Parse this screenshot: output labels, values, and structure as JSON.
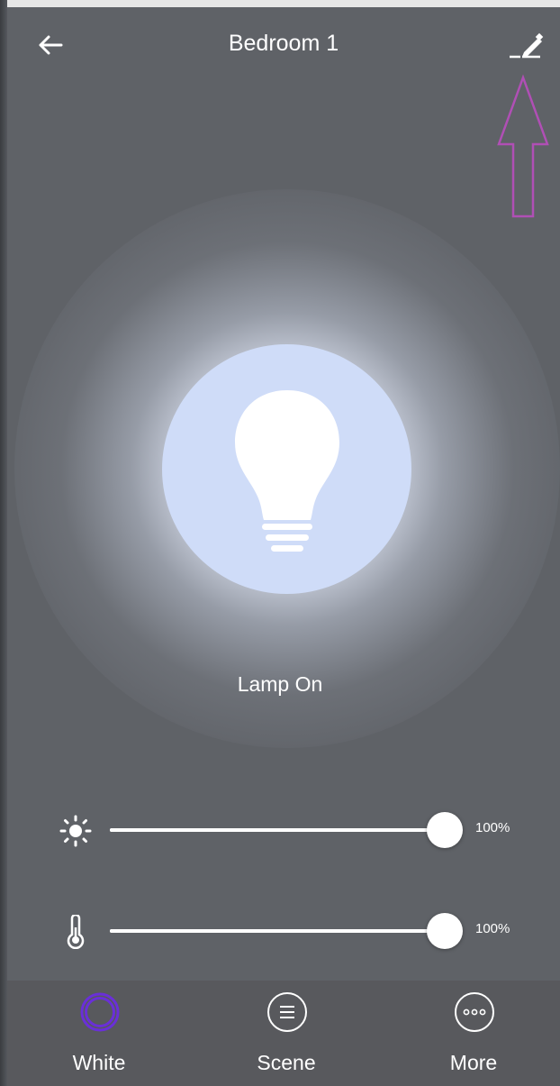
{
  "header": {
    "title": "Bedroom 1"
  },
  "icons": {
    "back": "arrow-left-icon",
    "edit": "pencil-edit-icon",
    "brightness": "sun-icon",
    "temperature": "thermometer-icon",
    "bulb": "light-bulb-icon",
    "white": "ring-icon",
    "scene": "menu-lines-icon",
    "more": "dots-icon"
  },
  "lamp": {
    "status": "Lamp On",
    "color": "#cfdcf8"
  },
  "sliders": {
    "brightness": {
      "value": 1.0,
      "label": "100%"
    },
    "temperature": {
      "value": 1.0,
      "label": "100%"
    }
  },
  "nav": {
    "items": [
      {
        "label": "White",
        "icon": "ring-icon",
        "active": true
      },
      {
        "label": "Scene",
        "icon": "menu-lines-icon",
        "active": false
      },
      {
        "label": "More",
        "icon": "dots-icon",
        "active": false
      }
    ],
    "active_color": "#6a2fd8"
  },
  "colors": {
    "background": "#5f6267",
    "nav_background": "#58595d",
    "annotation": "#b04fb5"
  }
}
